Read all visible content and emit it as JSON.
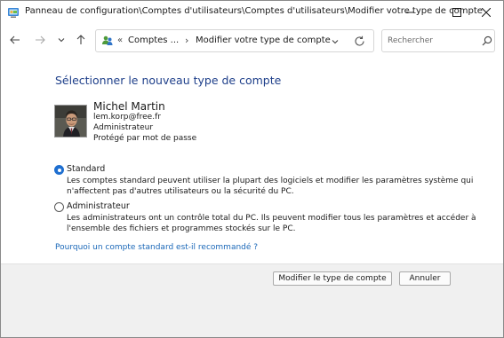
{
  "window": {
    "title": "Panneau de configuration\\Comptes d'utilisateurs\\Comptes d'utilisateurs\\Modifier votre type de compte"
  },
  "address_bar": {
    "crumbs": [
      "Comptes ...",
      "Modifier votre type de compte"
    ]
  },
  "search": {
    "placeholder": "Rechercher"
  },
  "main": {
    "heading": "Sélectionner le nouveau type de compte",
    "user": {
      "name": "Michel Martin",
      "email": "lem.korp@free.fr",
      "account_type": "Administrateur",
      "protection": "Protégé par mot de passe"
    },
    "options": [
      {
        "label": "Standard",
        "selected": true,
        "description": [
          "Les comptes standard peuvent utiliser la plupart des logiciels et modifier les paramètres système qui",
          "n'affectent pas d'autres utilisateurs ou la sécurité du PC."
        ]
      },
      {
        "label": "Administrateur",
        "selected": false,
        "description": [
          "Les administrateurs ont un contrôle total du PC. Ils peuvent modifier tous les paramètres et accéder à",
          "l'ensemble des fichiers et programmes stockés sur le PC."
        ]
      }
    ],
    "why_link": "Pourquoi un compte standard est-il recommandé ?"
  },
  "footer": {
    "change_button": "Modifier le type de compte",
    "cancel_button": "Annuler"
  }
}
